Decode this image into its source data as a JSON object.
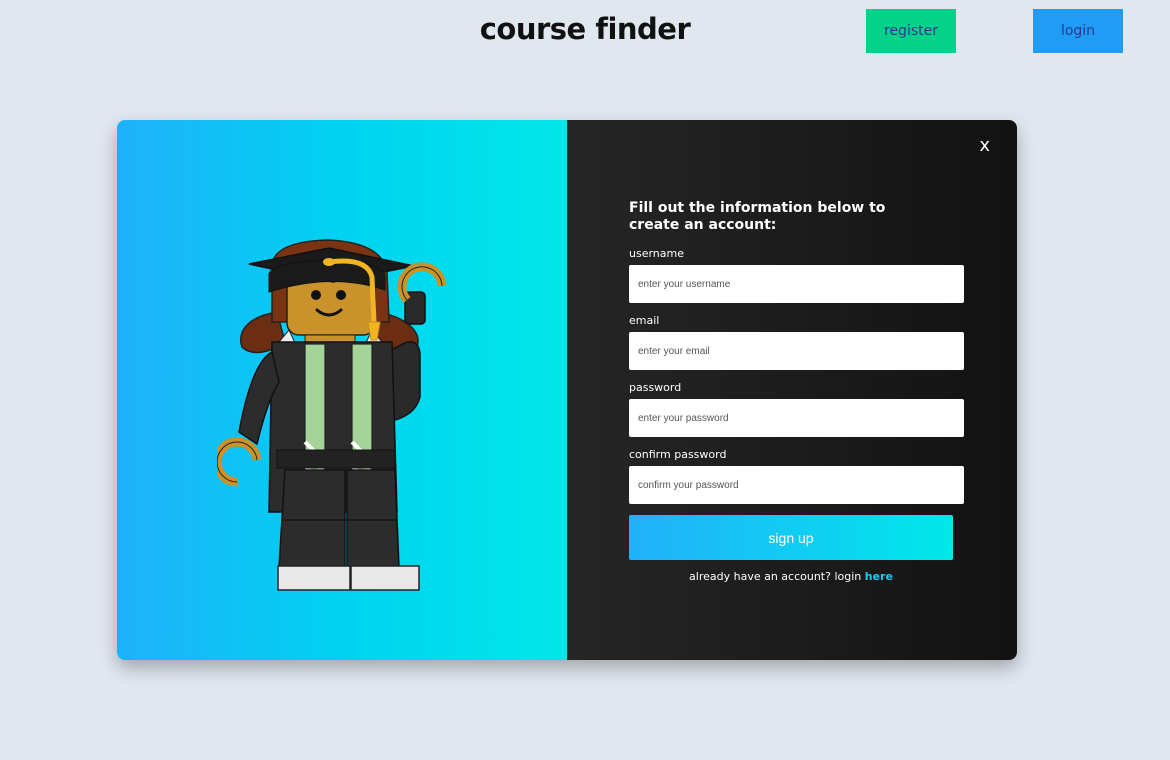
{
  "header": {
    "title": "course finder",
    "register_label": "register",
    "login_label": "login"
  },
  "modal": {
    "close_label": "x",
    "heading": "Fill out the information below to create an account:",
    "fields": [
      {
        "label": "username",
        "placeholder": "enter your username"
      },
      {
        "label": "email",
        "placeholder": "enter your email"
      },
      {
        "label": "password",
        "placeholder": "enter your password"
      },
      {
        "label": "confirm password",
        "placeholder": "confirm your password"
      }
    ],
    "signup_label": "sign up",
    "login_prompt": "already have an account? login",
    "login_link": "here"
  },
  "colors": {
    "background": "#e0e7ef",
    "register_button": "#04d28a",
    "login_button": "#1f9cf5",
    "gradient_start": "#1fb1fb",
    "gradient_end": "#00e8ea",
    "panel_dark": "#1c1c1c",
    "link": "#1ec9f8"
  },
  "illustration": {
    "icon": "lego-graduate-icon"
  }
}
